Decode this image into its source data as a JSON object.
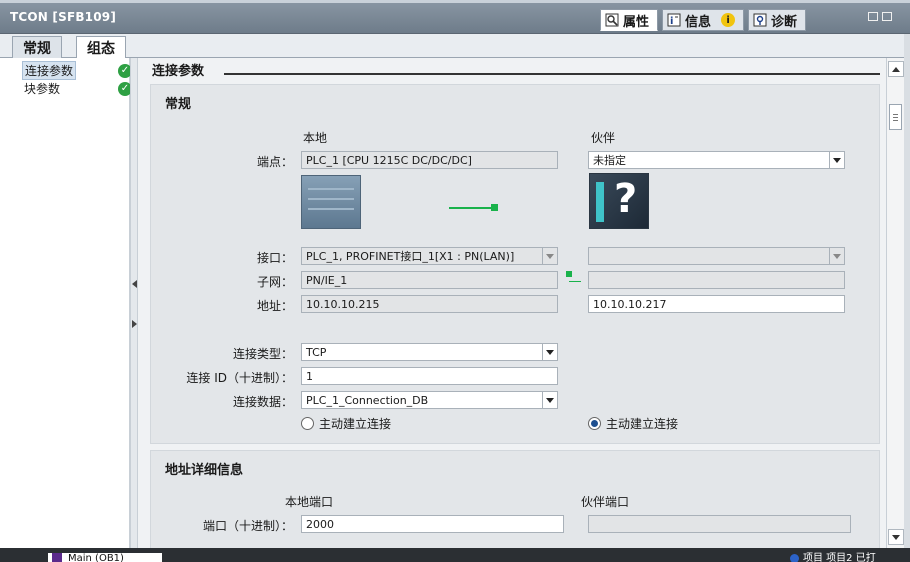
{
  "window": {
    "title": "TCON [SFB109]"
  },
  "inspector_tabs": [
    {
      "label": "属性",
      "icon": "properties-icon",
      "active": true
    },
    {
      "label": "信息",
      "icon": "info-icon",
      "active": false
    },
    {
      "label": "诊断",
      "icon": "diagnostics-icon",
      "active": false
    }
  ],
  "left_tabs": [
    {
      "label": "常规",
      "active": false
    },
    {
      "label": "组态",
      "active": true
    }
  ],
  "nav": {
    "items": [
      {
        "label": "连接参数",
        "selected": true,
        "status": "ok-icon"
      },
      {
        "label": "块参数",
        "selected": false,
        "status": "ok-icon"
      }
    ]
  },
  "section": {
    "title": "连接参数"
  },
  "general": {
    "title": "常规",
    "col_local": "本地",
    "col_partner": "伙伴",
    "endpoint_label": "端点：",
    "endpoint_local": "PLC_1 [CPU 1215C DC/DC/DC]",
    "endpoint_partner": "未指定",
    "interface_label": "接口：",
    "interface_local": "PLC_1, PROFINET接口_1[X1 : PN(LAN)]",
    "interface_partner": "",
    "subnet_label": "子网：",
    "subnet_local": "PN/IE_1",
    "subnet_partner": "",
    "address_label": "地址：",
    "address_local": "10.10.10.215",
    "address_partner": "10.10.10.217",
    "conn_type_label": "连接类型：",
    "conn_type": "TCP",
    "conn_id_label": "连接 ID（十进制）：",
    "conn_id": "1",
    "conn_data_label": "连接数据：",
    "conn_data": "PLC_1_Connection_DB",
    "active_local_label": "主动建立连接",
    "active_partner_label": "主动建立连接",
    "active_local_checked": false,
    "active_partner_checked": true
  },
  "address_details": {
    "title": "地址详细信息",
    "local_port_header": "本地端口",
    "partner_port_header": "伙伴端口",
    "port_label": "端口（十进制）：",
    "local_port": "2000",
    "partner_port": ""
  },
  "taskbar": {
    "item1": "Main (OB1)",
    "right_text": "项目 项目2 已打"
  },
  "colors": {
    "accent_connection": "#19b24b",
    "header_bar": "#7a8896",
    "ok_status": "#2ea043"
  }
}
